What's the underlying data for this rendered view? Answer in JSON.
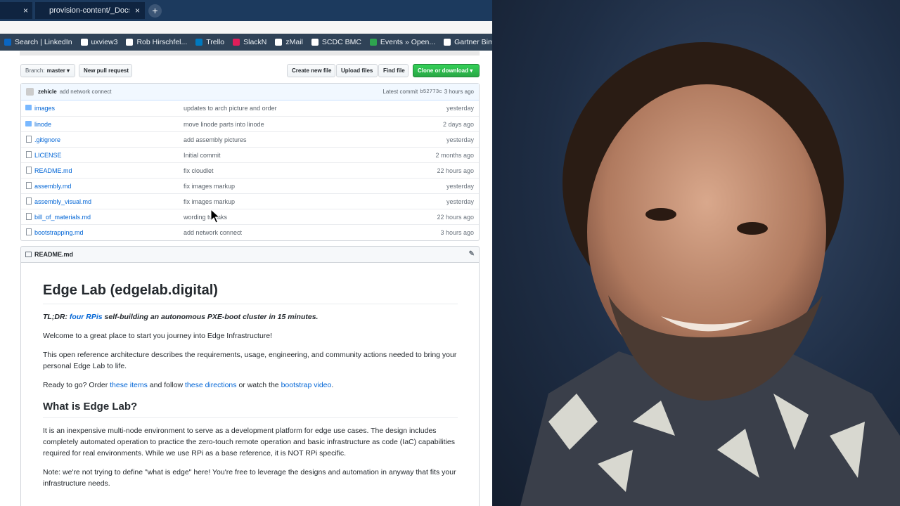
{
  "browser": {
    "tabs": [
      {
        "title": ""
      },
      {
        "title": "provision-content/_Docs"
      }
    ],
    "bookmarks": [
      {
        "label": "Search | LinkedIn",
        "icon": "linkedin-icon",
        "color": "#0a66c2"
      },
      {
        "label": "uxview3",
        "icon": "github-icon",
        "color": "#ffffff"
      },
      {
        "label": "Rob Hirschfel...",
        "icon": "github-icon",
        "color": "#ffffff"
      },
      {
        "label": "Trello",
        "icon": "trello-icon",
        "color": "#0079bf"
      },
      {
        "label": "SlackN",
        "icon": "slack-icon",
        "color": "#e01e5a"
      },
      {
        "label": "zMail",
        "icon": "zmail-icon",
        "color": "#ffffff"
      },
      {
        "label": "SCDC BMC",
        "icon": "globe-icon",
        "color": "#ffffff"
      },
      {
        "label": "Events » Open...",
        "icon": "openstack-icon",
        "color": "#2ea44f"
      },
      {
        "label": "Gartner Bimo...",
        "icon": "gartner-icon",
        "color": "#ffffff"
      }
    ]
  },
  "repo": {
    "branch_label": "Branch:",
    "branch_value": "master ▾",
    "new_pull_request": "New pull request",
    "create_new_file": "Create new file",
    "upload_files": "Upload files",
    "find_file": "Find file",
    "clone_download": "Clone or download ▾",
    "commit": {
      "author": "zehicle",
      "message": "add network connect",
      "latest_label": "Latest commit",
      "sha": "b52773c",
      "age": "3 hours ago"
    },
    "files": [
      {
        "type": "folder",
        "name": "images",
        "message": "updates to arch picture and order",
        "age": "yesterday"
      },
      {
        "type": "folder",
        "name": "linode",
        "message": "move linode parts into linode",
        "age": "2 days ago"
      },
      {
        "type": "file",
        "name": ".gitignore",
        "message": "add assembly pictures",
        "age": "yesterday"
      },
      {
        "type": "file",
        "name": "LICENSE",
        "message": "Initial commit",
        "age": "2 months ago"
      },
      {
        "type": "file",
        "name": "README.md",
        "message": "fix cloudlet",
        "age": "22 hours ago"
      },
      {
        "type": "file",
        "name": "assembly.md",
        "message": "fix images markup",
        "age": "yesterday"
      },
      {
        "type": "file",
        "name": "assembly_visual.md",
        "message": "fix images markup",
        "age": "yesterday"
      },
      {
        "type": "file",
        "name": "bill_of_materials.md",
        "message": "wording tweaks",
        "age": "22 hours ago"
      },
      {
        "type": "file",
        "name": "bootstrapping.md",
        "message": "add network connect",
        "age": "3 hours ago"
      }
    ],
    "readme_title": "README.md"
  },
  "readme": {
    "h1": "Edge Lab (edgelab.digital)",
    "tldr_prefix": "TL;DR:",
    "tldr_link": "four RPis",
    "tldr_rest": "self-building an autonomous PXE-boot cluster in 15 minutes.",
    "welcome": "Welcome to a great place to start you journey into Edge Infrastructure!",
    "intro": "This open reference architecture describes the requirements, usage, engineering, and community actions needed to bring your personal Edge Lab to life.",
    "ready_1": "Ready to go? Order",
    "ready_link1": "these items",
    "ready_2": "and follow",
    "ready_link2": "these directions",
    "ready_3": "or watch the",
    "ready_link3": "bootstrap video",
    "ready_4": ".",
    "h2": "What is Edge Lab?",
    "what": "It is an inexpensive multi-node environment to serve as a development platform for edge use cases. The design includes completely automated operation to practice the zero-touch remote operation and basic infrastructure as code (IaC) capabilities required for real environments. While we use RPi as a base reference, it is NOT RPi specific.",
    "note": "Note: we're not trying to define \"what is edge\" here! You're free to leverage the designs and automation in anyway that fits your infrastructure needs."
  }
}
